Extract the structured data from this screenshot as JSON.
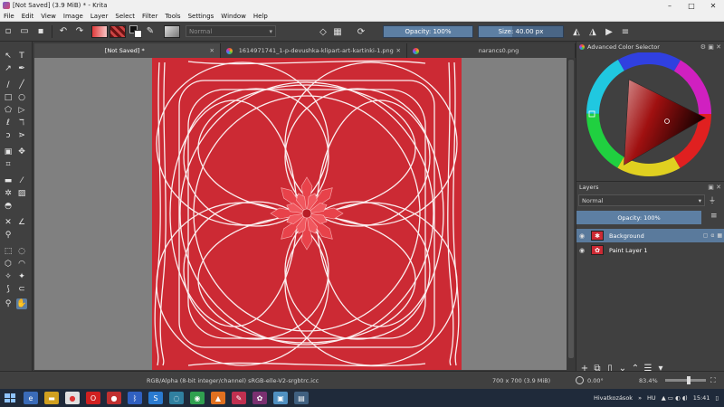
{
  "window": {
    "title": "[Not Saved]  (3.9 MiB)  * - Krita",
    "controls": [
      "–",
      "□",
      "✕"
    ]
  },
  "menu": [
    "File",
    "Edit",
    "View",
    "Image",
    "Layer",
    "Select",
    "Filter",
    "Tools",
    "Settings",
    "Window",
    "Help"
  ],
  "toolbar": {
    "blend_mode": "Normal",
    "opacity": "Opacity: 100%",
    "size": "Size: 40.00 px"
  },
  "tabs": [
    {
      "label": "[Not Saved]  *",
      "active": true
    },
    {
      "label": "1614971741_1-p-devushka-klipart-art-kartinki-1.png",
      "active": false
    },
    {
      "label": "narancs0.png",
      "active": false
    }
  ],
  "docker": {
    "color_selector_title": "Advanced Color Selector",
    "layers_title": "Layers",
    "layers_blend": "Normal",
    "layers_opacity": "Opacity:  100%",
    "layers": [
      {
        "name": "Background",
        "selected": true
      },
      {
        "name": "Paint Layer 1",
        "selected": false
      }
    ]
  },
  "status": {
    "color_model": "RGB/Alpha (8-bit integer/channel)   sRGB-elle-V2-srgbtrc.icc",
    "image_size": "700 x 700 (3.9 MiB)",
    "rotation": "0.00°",
    "zoom": "83.4%"
  },
  "taskbar": {
    "tray_label": "Hivatkozások",
    "language": "HU",
    "clock": "15:41"
  },
  "colors": {
    "canvas_red": "#cc2a34",
    "accent_blue": "#5d7fa3",
    "flower": "#e8424a"
  }
}
